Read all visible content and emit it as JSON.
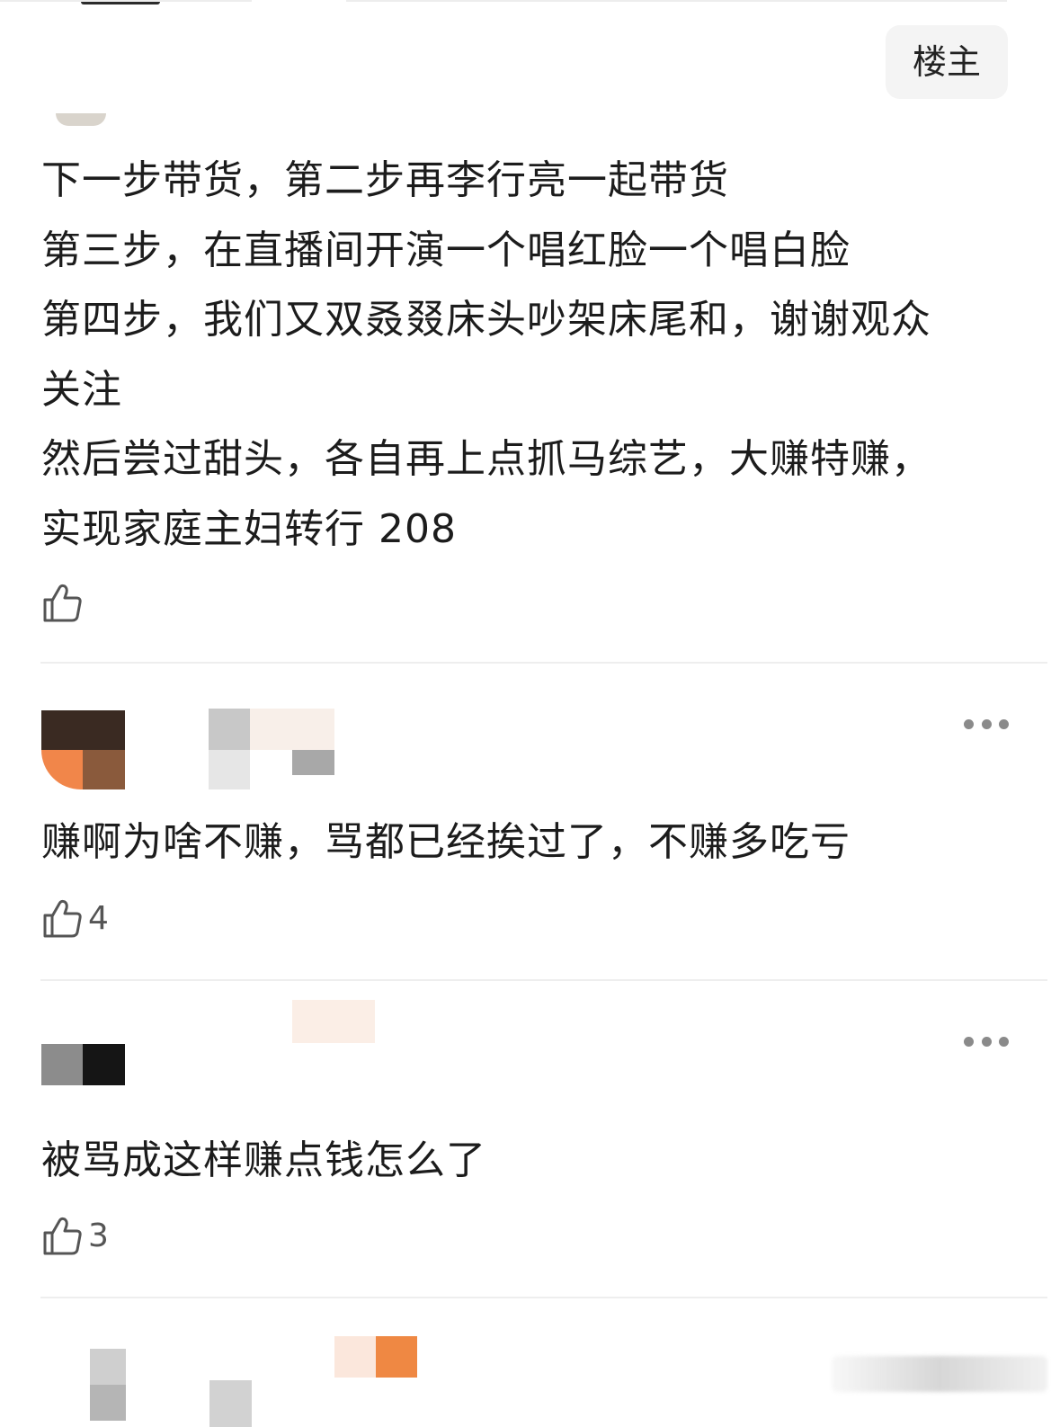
{
  "op_badge": "楼主",
  "comments": [
    {
      "lines": [
        "下一步带货，第二步再李行亮一起带货",
        "第三步，在直播间开演一个唱红脸一个唱白脸",
        "第四步，我们又双叒叕床头吵架床尾和，谢谢观众",
        "关注",
        "然后尝过甜头，各自再上点抓马综艺，大赚特赚，",
        "实现家庭主妇转行 208"
      ],
      "likes": ""
    },
    {
      "lines": [
        "赚啊为啥不赚，骂都已经挨过了，不赚多吃亏"
      ],
      "likes": "4"
    },
    {
      "lines": [
        "被骂成这样赚点钱怎么了"
      ],
      "likes": "3"
    }
  ],
  "icons": {
    "like": "thumbs-up-icon",
    "more": "more-dots-icon"
  },
  "colors": {
    "text": "#1c1c1c",
    "badge_bg": "#f4f4f4",
    "divider": "#eeeeee",
    "icon": "#555555"
  }
}
